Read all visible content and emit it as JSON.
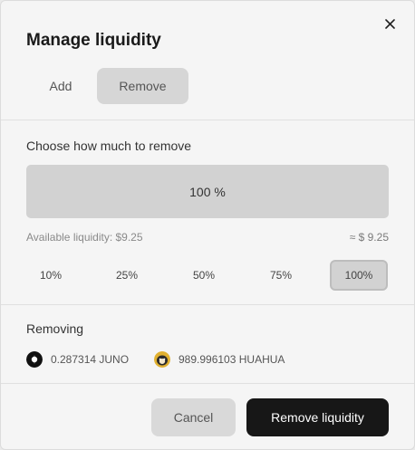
{
  "modal": {
    "title": "Manage liquidity",
    "tabs": {
      "add": "Add",
      "remove": "Remove"
    },
    "choose_label": "Choose how much to remove",
    "slider_value": "100 %",
    "available_liquidity": "Available liquidity: $9.25",
    "approx_value": "≈ $ 9.25",
    "percent_options": [
      "10%",
      "25%",
      "50%",
      "75%",
      "100%"
    ],
    "selected_percent": "100%",
    "removing_label": "Removing",
    "tokens": [
      {
        "amount": "0.287314 JUNO",
        "icon": "juno-token-icon"
      },
      {
        "amount": "989.996103 HUAHUA",
        "icon": "huahua-token-icon"
      }
    ],
    "buttons": {
      "cancel": "Cancel",
      "remove": "Remove liquidity"
    }
  },
  "colors": {
    "primary_button": "#171717",
    "selected_bg": "#d2d2d2",
    "modal_bg": "#f5f5f5"
  }
}
